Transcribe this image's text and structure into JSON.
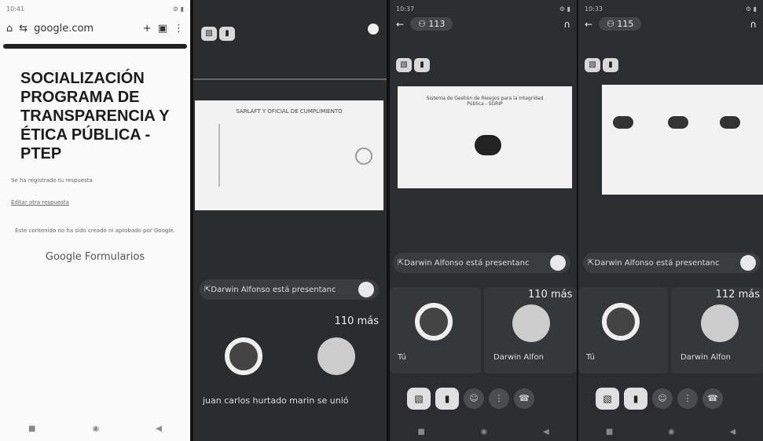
{
  "phone1": {
    "time": "10:41",
    "url": "google.com",
    "form_title": "SOCIALIZACIÓN PROGRAMA DE TRANSPARENCIA Y ÉTICA PÚBLICA - PTEP",
    "registered": "Se ha registrado tu respuesta",
    "edit_link": "Editar otra respuesta",
    "disclaimer": "Este contenido no ha sido creado ni aprobado por Google.",
    "brand": "Google",
    "brand_suffix": "Formularios"
  },
  "phone2": {
    "slide_title": "SARLAFT Y OFICIAL DE CUMPLIMIENTO",
    "presenting": "Darwin Alfonso está presentanc",
    "more": "110 más",
    "joined": "juan carlos hurtado marin se unió"
  },
  "phone3": {
    "time": "10:37",
    "participants": "113",
    "slide_title": "Sistema de Gestión de Riesgos para la Integridad Pública - SGRIP",
    "presenting": "Darwin Alfonso está presentanc",
    "more": "110 más",
    "you": "Tú",
    "other": "Darwin Alfon"
  },
  "phone4": {
    "time": "10:33",
    "participants": "115",
    "presenting": "Darwin Alfonso está presentanc",
    "more": "112 más",
    "you": "Tú",
    "other": "Darwin Alfon"
  }
}
